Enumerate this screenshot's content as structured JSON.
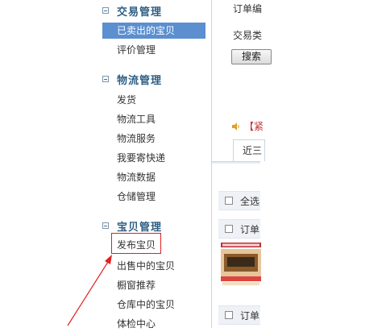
{
  "sidebar": {
    "groups": [
      {
        "title": "交易管理",
        "items": [
          {
            "label": "已卖出的宝贝",
            "active": true
          },
          {
            "label": "评价管理"
          }
        ]
      },
      {
        "title": "物流管理",
        "items": [
          {
            "label": "发货"
          },
          {
            "label": "物流工具"
          },
          {
            "label": "物流服务"
          },
          {
            "label": "我要寄快递"
          },
          {
            "label": "物流数据"
          },
          {
            "label": "仓储管理"
          }
        ]
      },
      {
        "title": "宝贝管理",
        "items": [
          {
            "label": "发布宝贝",
            "highlighted": true
          },
          {
            "label": "出售中的宝贝"
          },
          {
            "label": "橱窗推荐"
          },
          {
            "label": "仓库中的宝贝"
          },
          {
            "label": "体检中心"
          }
        ]
      }
    ]
  },
  "main": {
    "order_label": "订单编",
    "trade_type_label": "交易类",
    "search_button": "搜索",
    "notice_text": "【紧",
    "tab_label": "近三",
    "select_all": "全选",
    "order_row_1": "订单",
    "order_row_2": "订单"
  },
  "colors": {
    "active_bg": "#5b8fd0",
    "group_title": "#2f5f84",
    "highlight_border": "#e02020",
    "notice": "#c03030"
  }
}
